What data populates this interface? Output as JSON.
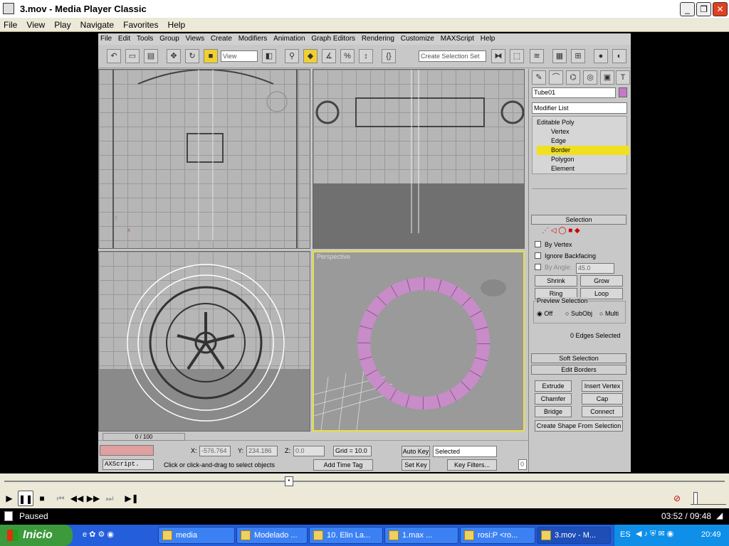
{
  "window": {
    "title": "3.mov - Media Player Classic"
  },
  "menu": [
    "File",
    "View",
    "Play",
    "Navigate",
    "Favorites",
    "Help"
  ],
  "max": {
    "menu": [
      "File",
      "Edit",
      "Tools",
      "Group",
      "Views",
      "Create",
      "Modifiers",
      "Animation",
      "Graph Editors",
      "Rendering",
      "Customize",
      "MAXScript",
      "Help"
    ],
    "view_combo": "View",
    "selection_set_placeholder": "Create Selection Set",
    "viewport_label": "Perspective",
    "object_name": "Tube01",
    "modifier_list": "Modifier List",
    "stack": [
      "Editable Poly",
      "Vertex",
      "Edge",
      "Border",
      "Polygon",
      "Element"
    ],
    "stack_selected": "Border",
    "selection_rollup": "Selection",
    "checkboxes": [
      "By Vertex",
      "Ignore Backfacing",
      "By Angle:"
    ],
    "angle_value": "45.0",
    "buttons": {
      "shrink": "Shrink",
      "grow": "Grow",
      "ring": "Ring",
      "loop": "Loop"
    },
    "preview_selection": "Preview Selection",
    "preview_options": [
      "Off",
      "SubObj",
      "Multi"
    ],
    "edges_selected": "0 Edges Selected",
    "soft_selection": "Soft Selection",
    "edit_borders": "Edit Borders",
    "border_buttons": {
      "extrude": "Extrude",
      "insert_vertex": "Insert Vertex",
      "chamfer": "Chamfer",
      "cap": "Cap",
      "bridge": "Bridge",
      "connect": "Connect"
    },
    "create_shape": "Create Shape From Selection",
    "timeline": "0 / 100",
    "script_label": "AXScript.",
    "x_label": "X:",
    "x_value": "-576.764",
    "y_label": "Y:",
    "y_value": "234.186",
    "z_label": "Z:",
    "z_value": "0.0",
    "grid": "Grid = 10.0",
    "auto_key": "Auto Key",
    "set_key": "Set Key",
    "key_mode": "Selected",
    "key_filters": "Key Filters...",
    "frame": "0",
    "status_prompt": "Click or click-and-drag to select objects",
    "add_time_tag": "Add Time Tag"
  },
  "player": {
    "status": "Paused",
    "time": "03:52 / 09:48",
    "seek_fraction": 0.395
  },
  "taskbar": {
    "start": "Inicio",
    "tasks": [
      "media",
      "Modelado ...",
      "10. Elin La...",
      "1.max    ...",
      "rosi:P <ro...",
      "3.mov - M..."
    ],
    "lang": "ES",
    "clock": "20:49"
  }
}
